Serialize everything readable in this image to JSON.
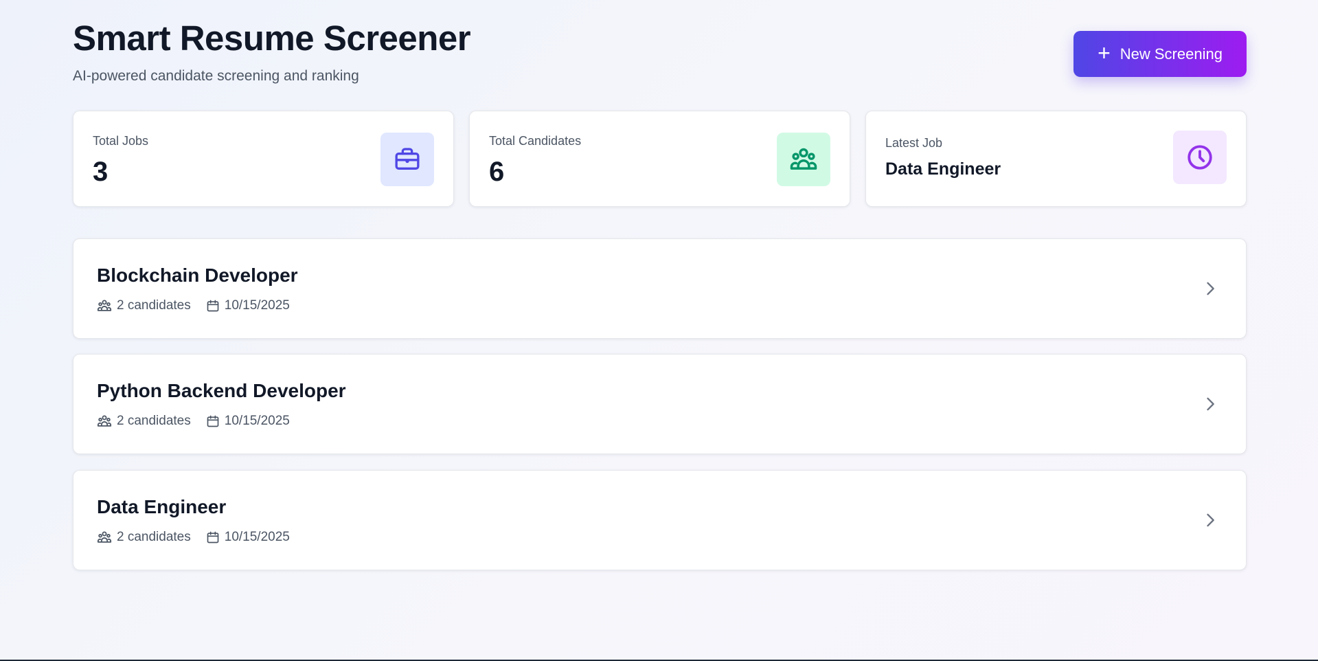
{
  "app": {
    "title": "Smart Resume Screener",
    "subtitle": "AI-powered candidate screening and ranking",
    "new_button_label": "New Screening"
  },
  "stats": [
    {
      "label": "Total Jobs",
      "value": "3",
      "icon": "briefcase-icon",
      "color": "#4f46e5"
    },
    {
      "label": "Total Candidates",
      "value": "6",
      "icon": "users-icon",
      "color": "#059669"
    },
    {
      "label": "Latest Job",
      "value": "Data Engineer",
      "icon": "clock-icon",
      "color": "#9333ea"
    }
  ],
  "jobs": [
    {
      "title": "Blockchain Developer",
      "candidates": "2 candidates",
      "date": "10/15/2025"
    },
    {
      "title": "Python Backend Developer",
      "candidates": "2 candidates",
      "date": "10/15/2025"
    },
    {
      "title": "Data Engineer",
      "candidates": "2 candidates",
      "date": "10/15/2025"
    }
  ],
  "colors": {
    "accent_start": "#4f46e5",
    "accent_end": "#9d1cf0"
  }
}
